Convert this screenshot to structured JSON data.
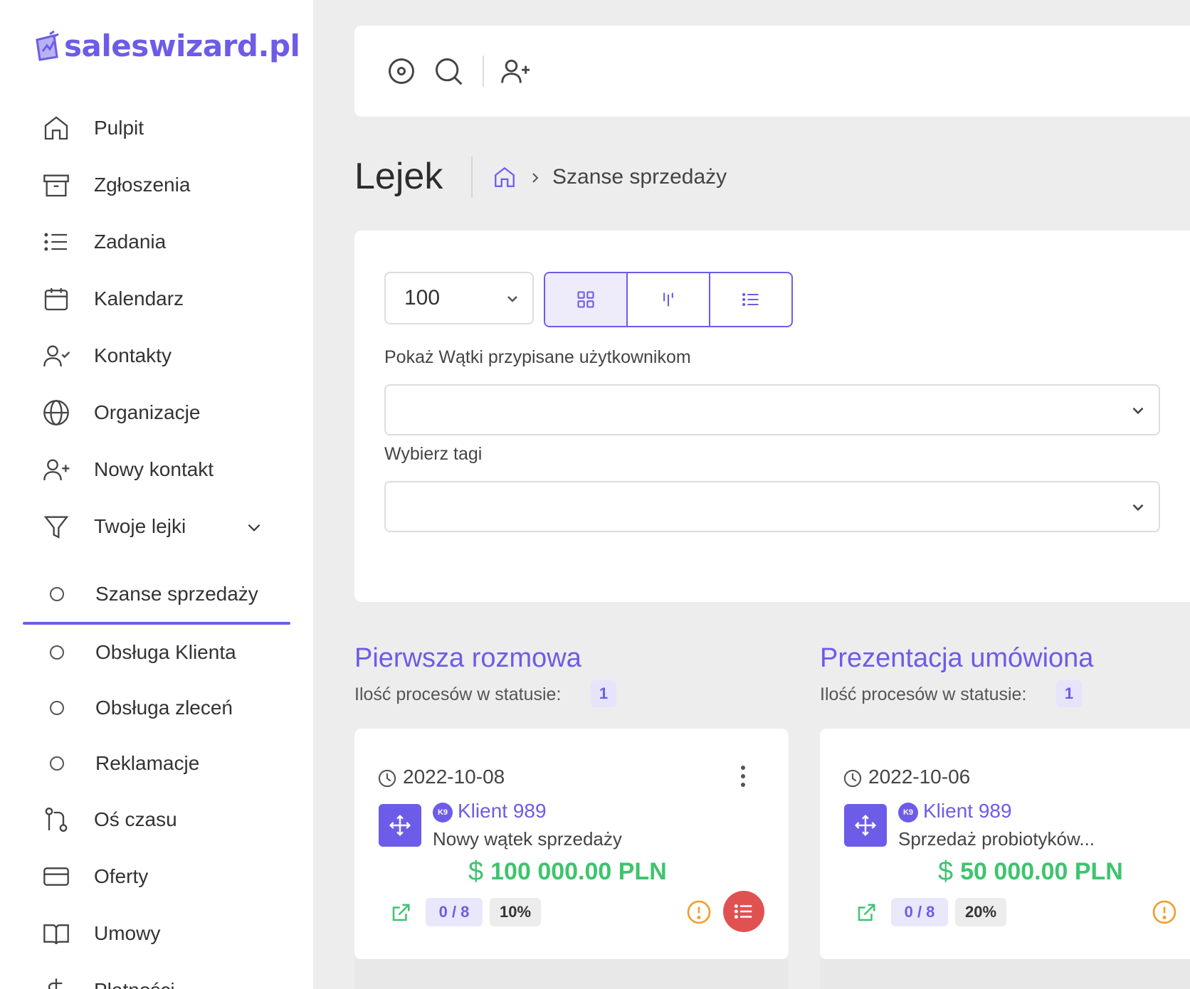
{
  "brand": {
    "name": "saleswizard.pl",
    "accent": "#6c5ce7"
  },
  "sidebar": {
    "items": [
      {
        "label": "Pulpit",
        "icon": "home-icon"
      },
      {
        "label": "Zgłoszenia",
        "icon": "archive-icon"
      },
      {
        "label": "Zadania",
        "icon": "list-icon"
      },
      {
        "label": "Kalendarz",
        "icon": "calendar-icon"
      },
      {
        "label": "Kontakty",
        "icon": "user-check-icon"
      },
      {
        "label": "Organizacje",
        "icon": "globe-icon"
      },
      {
        "label": "Nowy kontakt",
        "icon": "user-plus-icon"
      },
      {
        "label": "Twoje lejki",
        "icon": "funnel-icon"
      }
    ],
    "sub_items": [
      {
        "label": "Szanse sprzedaży",
        "active": true
      },
      {
        "label": "Obsługa Klienta"
      },
      {
        "label": "Obsługa zleceń"
      },
      {
        "label": "Reklamacje"
      }
    ],
    "items_after": [
      {
        "label": "Oś czasu",
        "icon": "git-pull-icon"
      },
      {
        "label": "Oferty",
        "icon": "credit-card-icon"
      },
      {
        "label": "Umowy",
        "icon": "book-icon"
      },
      {
        "label": "Płatności",
        "icon": "dollar-icon"
      }
    ]
  },
  "header": {
    "title": "Lejek",
    "breadcrumb": "Szanse sprzedaży"
  },
  "filters": {
    "page_size": "100",
    "users_label": "Pokaż Wątki przypisane użytkownikom",
    "tags_label": "Wybierz tagi"
  },
  "columns": [
    {
      "title": "Pierwsza rozmowa",
      "count_label": "Ilość procesów w statusie:",
      "count": "1",
      "card": {
        "date": "2022-10-08",
        "client_badge": "K9",
        "client": "Klient 989",
        "description": "Nowy wątek sprzedaży",
        "amount": "100 000.00 PLN",
        "steps": "0 / 8",
        "percent": "10%"
      }
    },
    {
      "title": "Prezentacja umówiona",
      "count_label": "Ilość procesów w statusie:",
      "count": "1",
      "card": {
        "date": "2022-10-06",
        "client_badge": "K9",
        "client": "Klient 989",
        "description": "Sprzedaż probiotyków...",
        "amount": "50 000.00 PLN",
        "steps": "0 / 8",
        "percent": "20%"
      }
    }
  ]
}
